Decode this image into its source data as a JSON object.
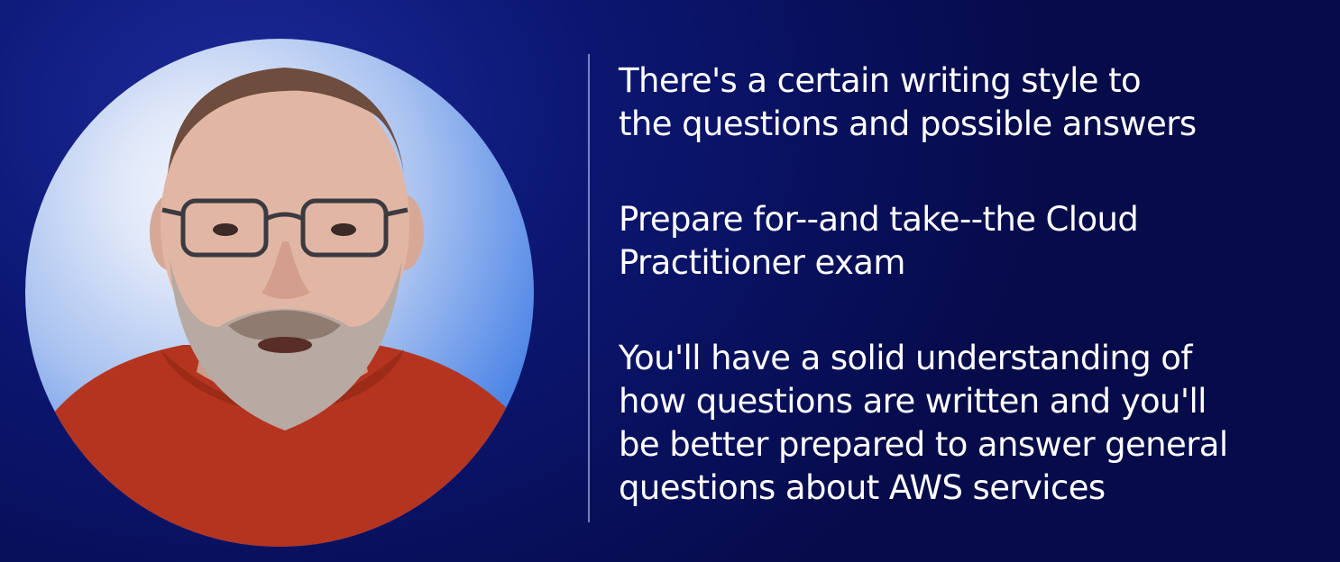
{
  "colors": {
    "background_dark": "#060b4a",
    "background_mid": "#0b1670",
    "circle_blue": "#2f6fe2",
    "divider": "#d2dcff",
    "text": "#ffffff",
    "shirt": "#b5341f"
  },
  "presenter": {
    "icon": "presenter-video-feed"
  },
  "points": [
    {
      "lines": [
        "There's a certain writing style to",
        "the questions and possible answers"
      ]
    },
    {
      "lines": [
        "Prepare for--and take--the Cloud",
        "Practitioner exam"
      ]
    },
    {
      "lines": [
        "You'll have a solid understanding of",
        "how questions are written and you'll",
        "be better prepared to answer general",
        "questions about AWS services"
      ]
    }
  ]
}
